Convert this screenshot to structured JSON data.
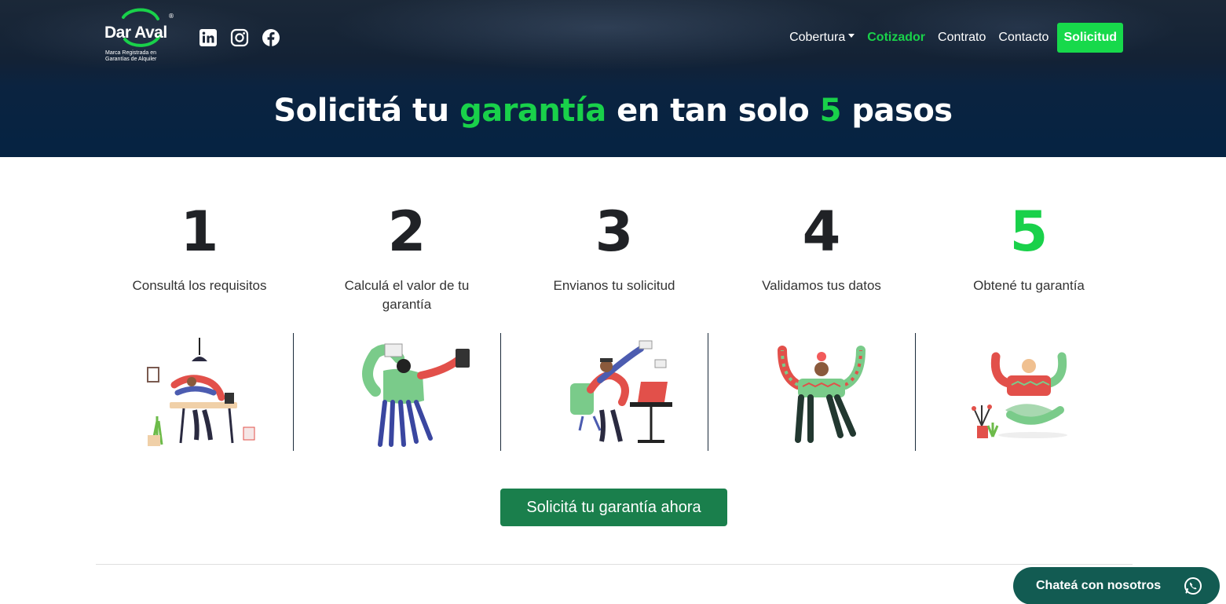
{
  "brand": {
    "name": "Dar Aval",
    "registered_mark": "®",
    "tagline": "Marca Registrada en Garantías de Alquiler"
  },
  "socials": [
    {
      "icon": "linkedin-icon"
    },
    {
      "icon": "instagram-icon"
    },
    {
      "icon": "facebook-icon"
    }
  ],
  "nav": {
    "items": [
      {
        "label": "Cobertura",
        "dropdown": true
      },
      {
        "label": "Cotizador",
        "active": true
      },
      {
        "label": "Contrato"
      },
      {
        "label": "Contacto"
      }
    ],
    "cta_label": "Solicitud"
  },
  "hero": {
    "title_part1": "Solicitá tu ",
    "title_accent1": "garantía",
    "title_part2": " en tan solo ",
    "title_accent2": "5",
    "title_part3": " pasos"
  },
  "steps": [
    {
      "number": "1",
      "label": "Consultá los requisitos",
      "illustration": "person-at-desk-illustration"
    },
    {
      "number": "2",
      "label": "Calculá el valor de tu garantía",
      "illustration": "person-with-calculator-illustration"
    },
    {
      "number": "3",
      "label": "Envianos tu solicitud",
      "illustration": "person-sending-mail-illustration"
    },
    {
      "number": "4",
      "label": "Validamos tus datos",
      "illustration": "person-with-lightbulb-illustration"
    },
    {
      "number": "5",
      "label": "Obtené tu garantía",
      "illustration": "person-celebrating-illustration",
      "highlight": true
    }
  ],
  "cta": {
    "label": "Solicitá tu garantía ahora"
  },
  "chat": {
    "label": "Chateá con nosotros",
    "icon": "whatsapp-icon"
  },
  "colors": {
    "accent_green": "#19d14a",
    "button_green": "#1a7f4c",
    "navy": "#052342",
    "chat_bg": "#125b52"
  }
}
